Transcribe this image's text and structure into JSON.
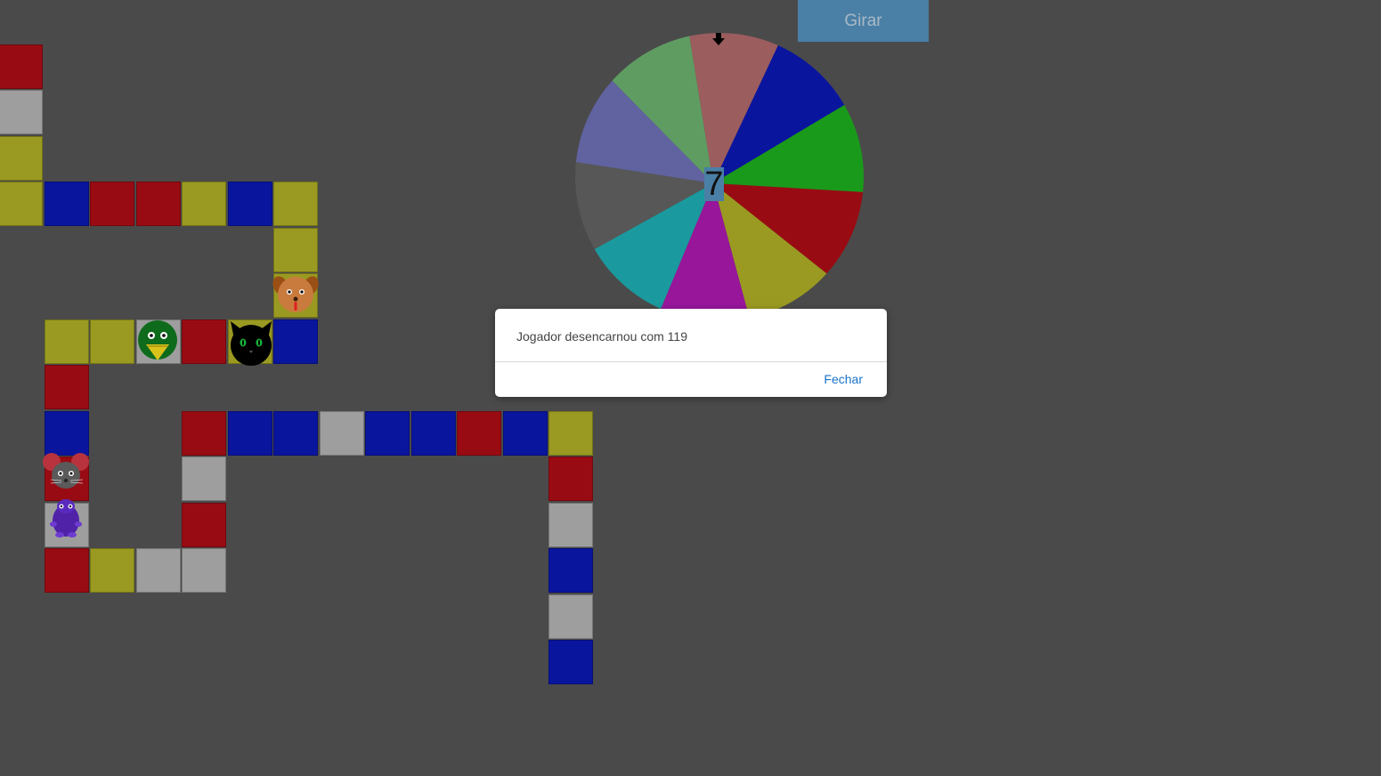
{
  "spin_button": {
    "label": "Girar"
  },
  "wheel": {
    "result": "7",
    "pointer_icon": "down-arrow-icon",
    "segment_colors": [
      "#6063a0",
      "#5f9c62",
      "#9b5d5e",
      "#0a159e",
      "#1a9a1a",
      "#990b13",
      "#9a9a22",
      "#97169a",
      "#1a9a9e",
      "#575757"
    ]
  },
  "dialog": {
    "message": "Jogador desencarnou com 119",
    "close_label": "Fechar"
  },
  "colors": {
    "R": "#990b13",
    "B": "#0a159e",
    "Y": "#9a9a22",
    "G": "#9e9e9e",
    "background": "#4a4a4a",
    "accent": "#4a7fa6"
  },
  "board": {
    "grid": [
      "",
      "R",
      "G",
      "Y",
      "YBRRYBY",
      "      Y",
      "      Y",
      " YYGRYB",
      " R",
      " B  RBBGBBRBY",
      " R  G       R",
      " G  R       G",
      " RYGG       B",
      "            G",
      "            B"
    ]
  },
  "pieces": [
    {
      "name": "dog-token",
      "icon": "dog-icon",
      "row": 6,
      "col": 6
    },
    {
      "name": "duck-token",
      "icon": "duck-icon",
      "row": 7,
      "col": 3
    },
    {
      "name": "cat-token",
      "icon": "cat-icon",
      "row": 7,
      "col": 5
    },
    {
      "name": "mouse-token",
      "icon": "mouse-icon",
      "row": 10,
      "col": 1
    },
    {
      "name": "purple-creature-token",
      "icon": "purple-creature-icon",
      "row": 11,
      "col": 1
    }
  ]
}
